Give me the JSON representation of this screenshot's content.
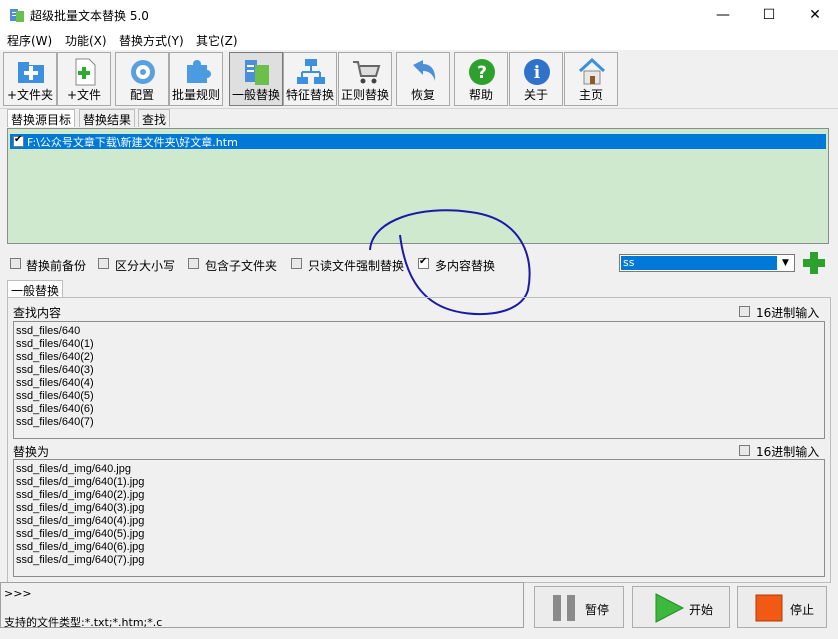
{
  "window": {
    "title": "超级批量文本替换 5.0",
    "controls": {
      "minimize": "—",
      "maximize": "☐",
      "close": "✕"
    }
  },
  "menu": [
    "程序(W)",
    "功能(X)",
    "替换方式(Y)",
    "其它(Z)"
  ],
  "toolbar": [
    {
      "label": "+文件夹",
      "icon": "add-folder-icon"
    },
    {
      "label": "+文件",
      "icon": "add-file-icon"
    },
    {
      "label": "配置",
      "icon": "settings-icon"
    },
    {
      "label": "批量规则",
      "icon": "puzzle-icon"
    },
    {
      "label": "一般替换",
      "icon": "replace-icon",
      "active": true
    },
    {
      "label": "特征替换",
      "icon": "network-icon"
    },
    {
      "label": "正则替换",
      "icon": "cart-icon"
    },
    {
      "label": "恢复",
      "icon": "undo-icon"
    },
    {
      "label": "帮助",
      "icon": "help-icon"
    },
    {
      "label": "关于",
      "icon": "info-icon"
    },
    {
      "label": "主页",
      "icon": "home-icon"
    }
  ],
  "tabs": [
    "替换源目标",
    "替换结果",
    "查找"
  ],
  "files": [
    {
      "path": "F:\\公众号文章下载\\新建文件夹\\好文章.htm",
      "checked": true
    }
  ],
  "options": [
    {
      "label": "替换前备份",
      "checked": false
    },
    {
      "label": "区分大小写",
      "checked": false
    },
    {
      "label": "包含子文件夹",
      "checked": false
    },
    {
      "label": "只读文件强制替换",
      "checked": false
    },
    {
      "label": "多内容替换",
      "checked": true
    }
  ],
  "combo": {
    "value": "ss"
  },
  "subtab": "一般替换",
  "find": {
    "label": "查找内容",
    "hex_label": "16进制输入",
    "lines": [
      "ssd_files/640",
      "ssd_files/640(1)",
      "ssd_files/640(2)",
      "ssd_files/640(3)",
      "ssd_files/640(4)",
      "ssd_files/640(5)",
      "ssd_files/640(6)",
      "ssd_files/640(7)"
    ]
  },
  "replace": {
    "label": "替换为",
    "hex_label": "16进制输入",
    "lines": [
      "ssd_files/d_img/640.jpg",
      "ssd_files/d_img/640(1).jpg",
      "ssd_files/d_img/640(2).jpg",
      "ssd_files/d_img/640(3).jpg",
      "ssd_files/d_img/640(4).jpg",
      "ssd_files/d_img/640(5).jpg",
      "ssd_files/d_img/640(6).jpg",
      "ssd_files/d_img/640(7).jpg"
    ]
  },
  "log": {
    "prompt": ">>>"
  },
  "actions": {
    "pause": "暂停",
    "start": "开始",
    "stop": "停止"
  },
  "status": {
    "file_types": "支持的文件类型:*.txt;*.htm;*.c"
  },
  "colors": {
    "selection": "#0078d7",
    "list_bg": "#cfe9cf",
    "annotation": "#1a1aa8"
  }
}
